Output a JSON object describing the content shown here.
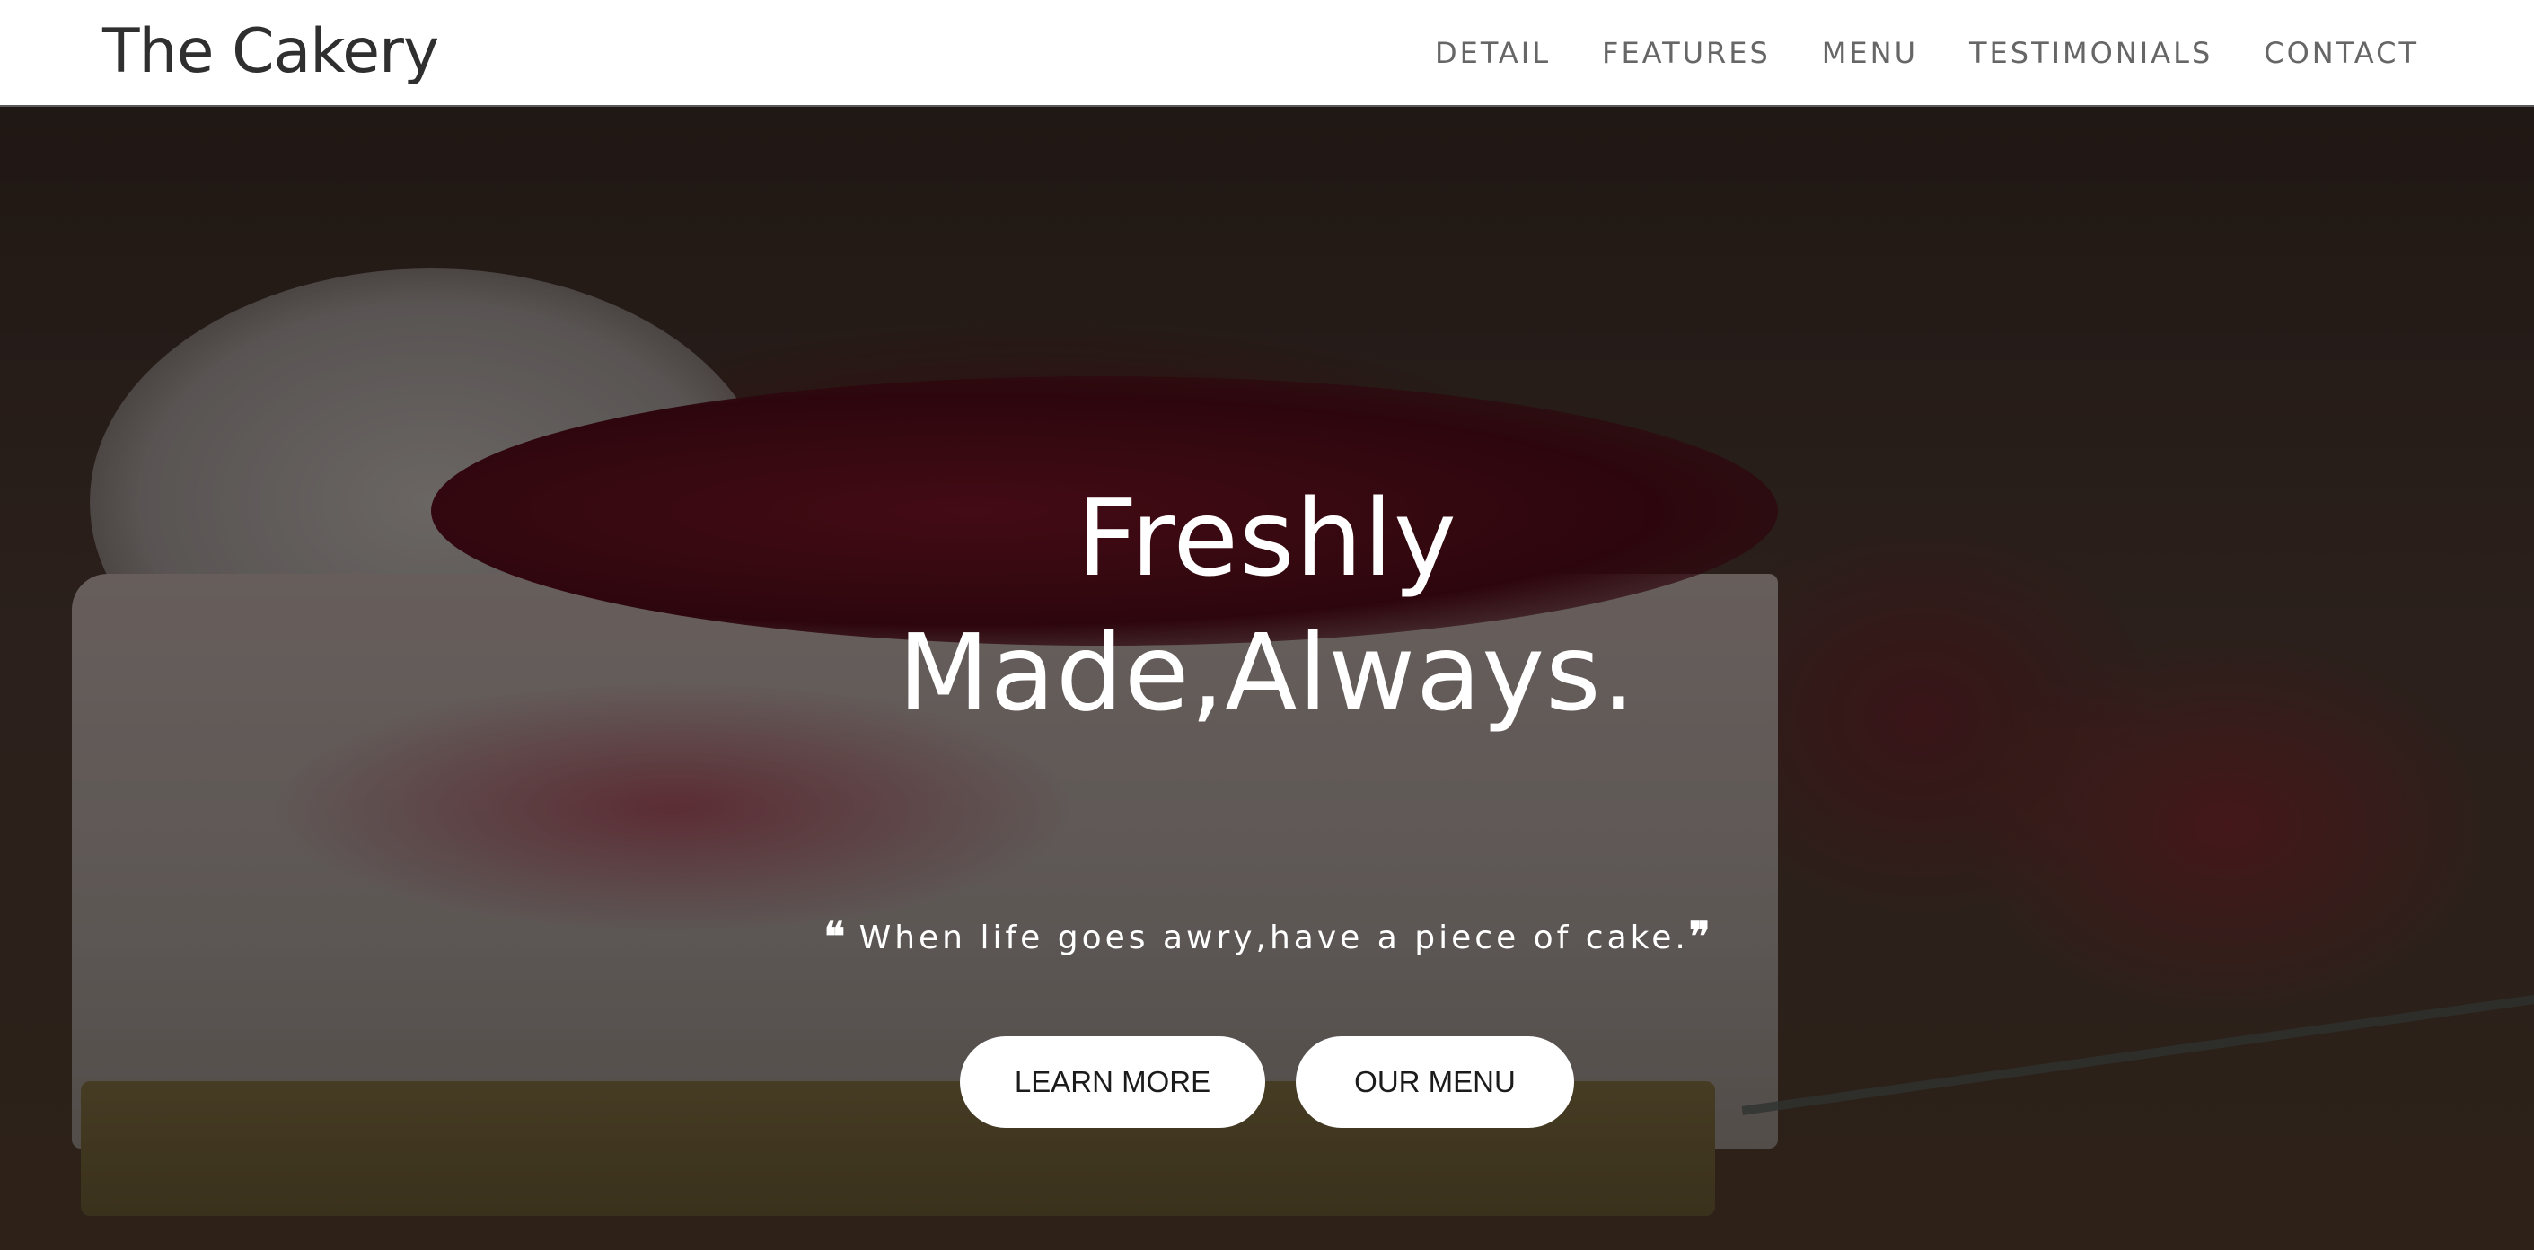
{
  "navbar": {
    "brand": "The Cakery",
    "links": [
      "DETAIL",
      "FEATURES",
      "MENU",
      "TESTIMONIALS",
      "CONTACT"
    ]
  },
  "hero": {
    "title_line1": "Freshly",
    "title_line2": "Made,Always.",
    "quote_open": "❝",
    "quote_text": "When life goes awry,have a piece of cake.",
    "quote_close": "❞",
    "buttons": {
      "learn_more": "LEARN MORE",
      "our_menu": "OUR MENU"
    }
  },
  "colors": {
    "navbar_bg": "#ffffff",
    "brand_text": "#2f2f2f",
    "nav_text": "#666666",
    "hero_text": "#ffffff",
    "button_bg": "#ffffff",
    "button_text": "#1b1b1b"
  },
  "icons": [
    "quote-open-icon",
    "quote-close-icon"
  ]
}
